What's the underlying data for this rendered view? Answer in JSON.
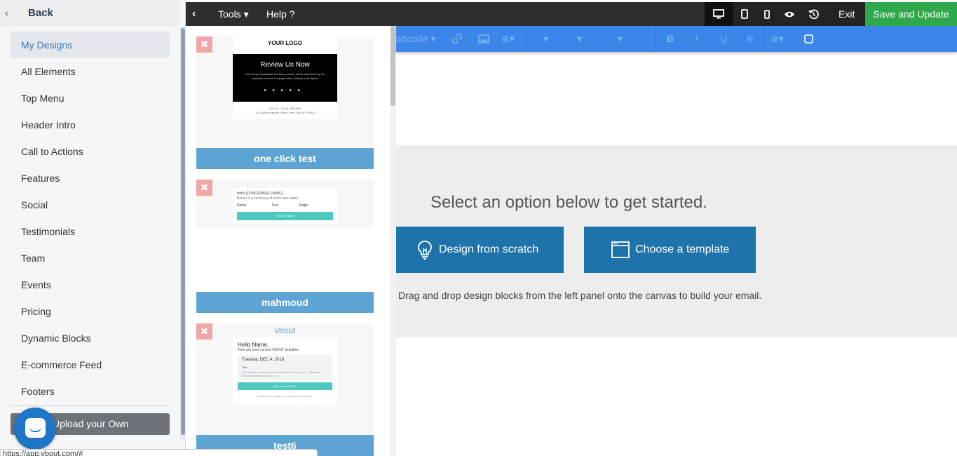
{
  "sidebar": {
    "back_label": "Back",
    "items": [
      {
        "label": "My Designs",
        "active": true
      },
      {
        "label": "All Elements"
      },
      {
        "label": "Top Menu"
      },
      {
        "label": "Header Intro"
      },
      {
        "label": "Call to Actions"
      },
      {
        "label": "Features"
      },
      {
        "label": "Social"
      },
      {
        "label": "Testimonials"
      },
      {
        "label": "Team"
      },
      {
        "label": "Events"
      },
      {
        "label": "Pricing"
      },
      {
        "label": "Dynamic Blocks"
      },
      {
        "label": "E-commerce Feed"
      },
      {
        "label": "Footers"
      }
    ],
    "upload_label": "Upload your Own"
  },
  "status_url": "https://app.vbout.com/#",
  "toolbar": {
    "tools_label": "Tools",
    "help_label": "Help ?",
    "exit_label": "Exit",
    "save_label": "Save and Update",
    "view_icons": [
      "desktop-icon",
      "tablet-icon",
      "mobile-icon",
      "preview-eye-icon",
      "history-icon"
    ]
  },
  "format_bar": {
    "shortcode_label": "ortcode",
    "bold": "B",
    "italic": "I",
    "underline": "U",
    "strike": "S"
  },
  "templates": [
    {
      "title": "one click test",
      "preview": {
        "logo": "YOUR LOGO",
        "heading": "Review Us Now",
        "body": "It is a long established fact that a reader will be distracted by the readable content of a page when looking at its layout.",
        "footer_line1": "Call Us: 1 (123) 456-7890",
        "footer_line2": "123 North example Street, New York, NY 00000"
      }
    },
    {
      "title": "mahmoud",
      "preview": {
        "greeting": "Hello [CONCERNED_NAME],",
        "summary": "Below is a summary of tasks due today:",
        "col1": "Name",
        "col2": "Due",
        "col3": "Stage",
        "button": "View All Tasks"
      }
    },
    {
      "title": "test6",
      "preview": {
        "brand": "vbout",
        "greeting": "Hello Name,",
        "subtitle": "Here are your current VBOUT activities:",
        "date": "Tuesday, DEC 4, 2018",
        "item_title": "Title",
        "item_desc": "Jeff Maudru - Metatron Communications Group, Inc. - Metatron Communications Group, Inc.",
        "button": "Take me to VBOUT",
        "footer": "Emails may not available and / get sended are all registers"
      }
    }
  ],
  "canvas": {
    "prompt": "Select an option below to get started.",
    "design_scratch_label": "Design from scratch",
    "choose_template_label": "Choose a template",
    "hint": "Drag and drop design blocks from the left panel onto the canvas to build your email."
  }
}
